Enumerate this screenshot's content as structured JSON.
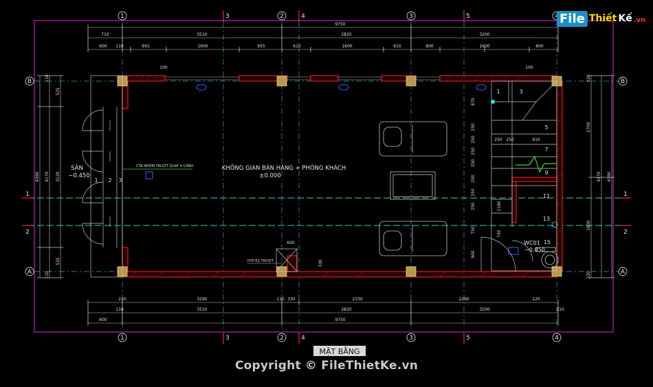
{
  "logo": {
    "f": "File",
    "t": "Thiết",
    "k": "Kế",
    "v": ".vn"
  },
  "room_label": "KHÔNG GIAN BÁN HÀNG + PHÒNG KHÁCH",
  "room_level": "±0.000",
  "san_label": "SÂN",
  "san_level": "−0.450",
  "door_note": "CTA NHÔM TRƯỢT QUAY 4 CÁNH",
  "wc_label": "WC01",
  "wc_level": "−0.050",
  "htp_note": "HTP K2 THƯỢT",
  "title": "MẶT BẰNG",
  "copyright": "Copyright © FileThietKe.vn",
  "axes_v": [
    "1",
    "3",
    "2",
    "4",
    "3",
    "5",
    "4"
  ],
  "axes_h": [
    "B",
    "1",
    "2",
    "A"
  ],
  "dims": {
    "top_total": "9750",
    "top_row1": [
      "710",
      "3510",
      "2820",
      "3200"
    ],
    "top_row2": [
      "600",
      "110",
      "955",
      "1600",
      "955",
      "610",
      "1600",
      "610",
      "800",
      "1600",
      "800"
    ],
    "bottom_row1": [
      "220",
      "3290",
      "110",
      "330",
      "2330",
      "2290",
      "220"
    ],
    "bottom_row2": [
      "110",
      "3510",
      "2820",
      "3200",
      "110"
    ],
    "bottom_total": "9750",
    "bottom_600": "600",
    "left": [
      "4390",
      "4170",
      "3120",
      "525",
      "525",
      "110",
      "110"
    ],
    "right": [
      "4390",
      "4170",
      "2700",
      "1830",
      "220",
      "220"
    ],
    "stair_left": [
      "870",
      "250",
      "250",
      "250",
      "250",
      "250",
      "250",
      "250",
      "750",
      "900"
    ],
    "stair_top": [
      "250",
      "250",
      "910"
    ],
    "misc": [
      "600",
      "330",
      "100",
      "100",
      "1190"
    ]
  },
  "stair_nums": [
    "1",
    "3",
    "5",
    "7",
    "9",
    "11",
    "13",
    "15"
  ],
  "door_nums": [
    "1",
    "2",
    "3"
  ]
}
